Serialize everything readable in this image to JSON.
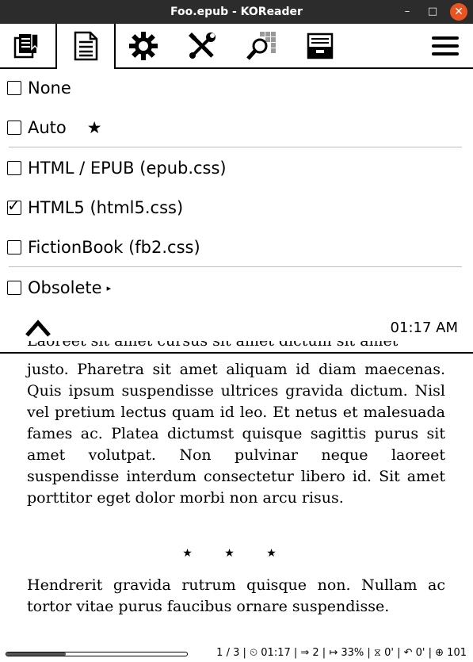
{
  "window": {
    "title": "Foo.epub - KOReader",
    "minimize": "–",
    "maximize": "□",
    "close": "✕"
  },
  "tabs": [
    {
      "name": "bookmarks",
      "icon": "bookmark-list-icon"
    },
    {
      "name": "document",
      "icon": "document-icon",
      "active": true
    },
    {
      "name": "settings",
      "icon": "gear-icon"
    },
    {
      "name": "tools",
      "icon": "tools-icon"
    },
    {
      "name": "search",
      "icon": "search-icon"
    },
    {
      "name": "filemanager",
      "icon": "file-cabinet-icon"
    },
    {
      "name": "main",
      "icon": "hamburger-menu-icon"
    }
  ],
  "menu": {
    "items": [
      {
        "label": "None",
        "checked": false
      },
      {
        "label": "Auto",
        "checked": false,
        "suffix": "★"
      },
      {
        "label": "HTML / EPUB (epub.css)",
        "checked": false
      },
      {
        "label": "HTML5 (html5.css)",
        "checked": true
      },
      {
        "label": "FictionBook (fb2.css)",
        "checked": false
      },
      {
        "label": "Obsolete",
        "checked": false,
        "suffix": "▸"
      }
    ],
    "check_mark": "✓",
    "time": "01:17 AM"
  },
  "book": {
    "partial_line": "Laoreet sit amet cursus sit amet dictum sit amet",
    "paragraph1": "justo. Pharetra sit amet aliquam id diam maecenas. Quis ipsum suspendisse ultrices gravida dictum. Nisl vel pretium lectus quam id leo. Et netus et malesuada fames ac. Platea dictumst quisque sagit­tis purus sit amet volutpat. Non pulvinar neque laoreet suspendisse interdum consectetur libero id. Sit amet porttitor eget dolor morbi non arcu risus.",
    "separator": "★ ★ ★",
    "paragraph2": "Hendrerit gravida rutrum quisque non. Nullam ac tortor vitae purus faucibus ornare suspendisse."
  },
  "status": {
    "progress": 0.33,
    "text": "1 / 3 | ⏲ 01:17 | ⇒ 2 | ↦ 33% | ⧖ 0' | ↶ 0' | ⊕ 101"
  }
}
